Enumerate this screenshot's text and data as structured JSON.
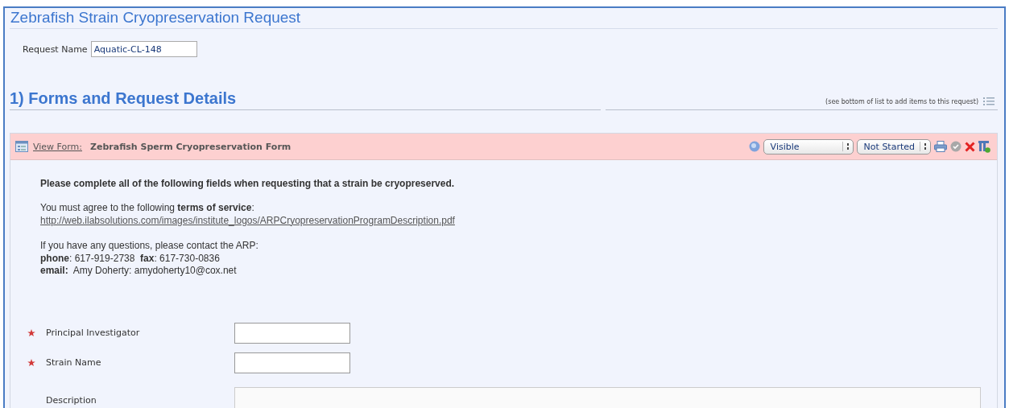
{
  "page_title": "Zebrafish Strain Cryopreservation Request",
  "request_name": {
    "label": "Request Name",
    "value": "Aquatic-CL-148"
  },
  "section": {
    "heading": "1) Forms and Request Details",
    "hint": "(see bottom of list to add items to this request)"
  },
  "form": {
    "link": "View Form:",
    "title": "Zebrafish Sperm Cryopreservation Form",
    "visibility": "Visible",
    "status": "Not Started",
    "intro": "Please complete all of the following fields when requesting that a strain be cryopreserved.",
    "terms_text": "You must agree to the following **terms of service**:",
    "terms_link": "http://web.ilabsolutions.com/images/institute_logos/ARPCryopreservationProgramDescription.pdf",
    "contact_lines": [
      "If you have any questions, please contact the ARP:",
      "**phone**: 617-919-2738  **fax**: 617-730-0836",
      "**email:**  Amy Doherty: amydoherty10@cox.net"
    ],
    "fields": [
      {
        "label": "Principal Investigator",
        "required": true,
        "kind": "text"
      },
      {
        "label": "Strain Name",
        "required": true,
        "kind": "text"
      },
      {
        "label": "Description",
        "required": false,
        "kind": "textarea"
      }
    ]
  }
}
